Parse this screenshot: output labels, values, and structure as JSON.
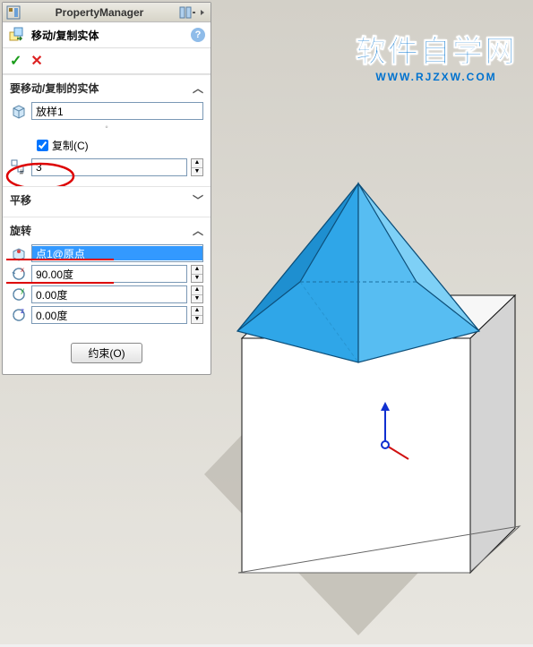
{
  "watermark": {
    "cn": "软件自学网",
    "url": "WWW.RJZXW.COM"
  },
  "titlebar": {
    "title": "PropertyManager"
  },
  "feature": {
    "title": "移动/复制实体"
  },
  "section_bodies": {
    "head": "要移动/复制的实体",
    "body_name": "放样1",
    "copy_label": "复制(C)",
    "copy_checked": true,
    "copy_count": "3"
  },
  "section_translate": {
    "head": "平移"
  },
  "section_rotate": {
    "head": "旋转",
    "axis_ref": "点1@原点",
    "rx": "90.00度",
    "ry": "0.00度",
    "rz": "0.00度"
  },
  "constraint_btn": "约束(O)",
  "icons": {
    "title": "layout-icon",
    "pin": "pin-icon",
    "feature": "move-copy-icon",
    "help": "?",
    "ok": "✓",
    "cancel": "✕",
    "body_box": "cube-icon",
    "pattern": "pattern-count-icon",
    "rot_origin": "rotate-origin-icon",
    "rx": "rotate-x-icon",
    "ry": "rotate-y-icon",
    "rz": "rotate-z-icon"
  }
}
